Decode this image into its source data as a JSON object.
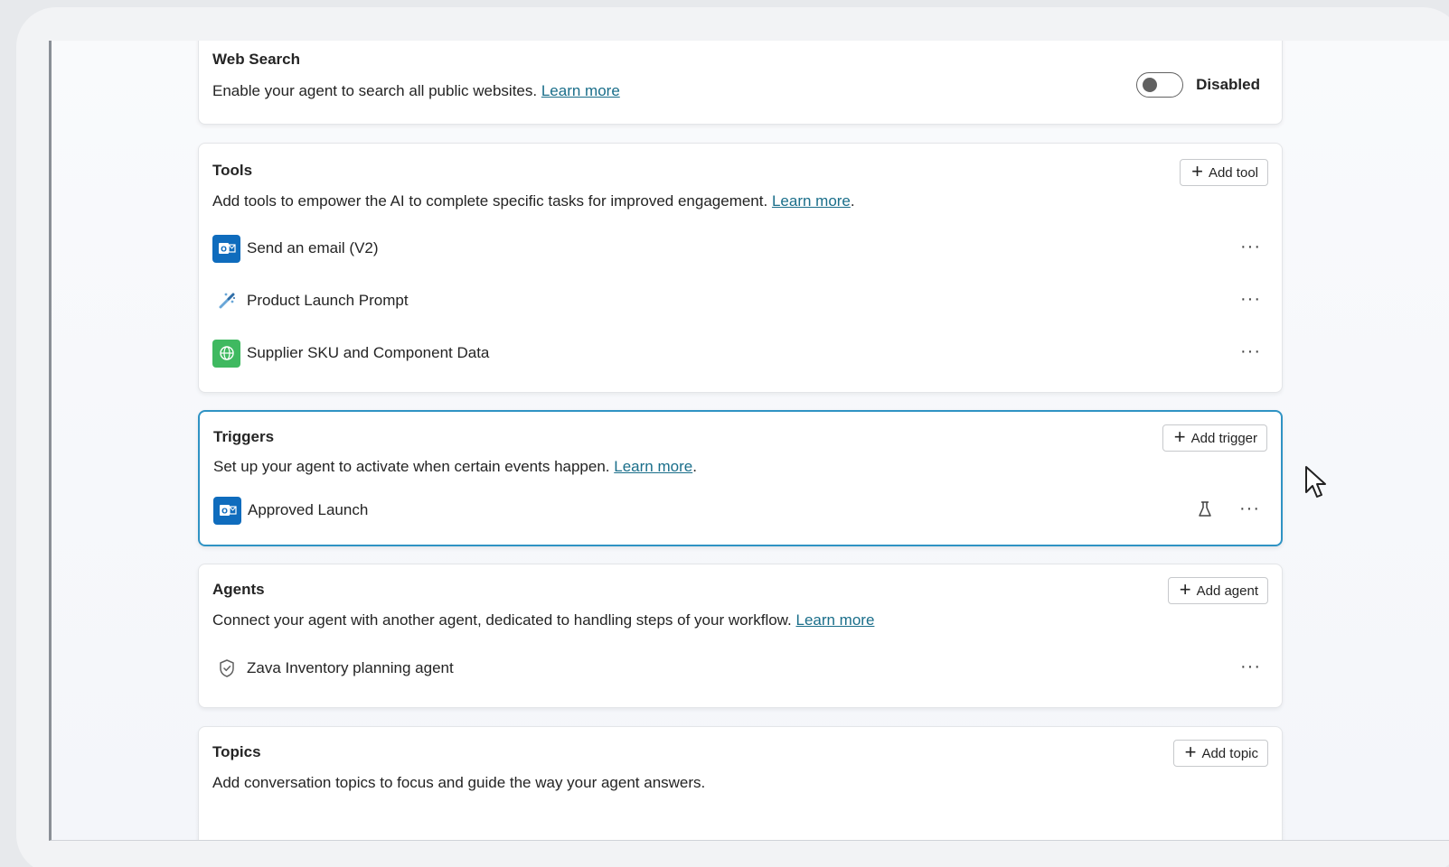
{
  "web_search": {
    "title": "Web Search",
    "description": "Enable your agent to search all public websites.",
    "link": "Learn more",
    "toggle_state": "Disabled"
  },
  "tools": {
    "title": "Tools",
    "description": "Add tools to empower the AI to complete specific tasks for improved engagement.",
    "link": "Learn more",
    "link_suffix": ".",
    "add_label": "Add tool",
    "items": [
      {
        "label": "Send an email (V2)",
        "icon": "outlook-icon"
      },
      {
        "label": "Product Launch Prompt",
        "icon": "prompt-icon"
      },
      {
        "label": "Supplier SKU and Component Data",
        "icon": "dataverse-icon"
      }
    ]
  },
  "triggers": {
    "title": "Triggers",
    "description": "Set up your agent to activate when certain events happen.",
    "link": "Learn more",
    "link_suffix": ".",
    "add_label": "Add trigger",
    "items": [
      {
        "label": "Approved Launch",
        "icon": "outlook-icon"
      }
    ]
  },
  "agents": {
    "title": "Agents",
    "description": "Connect your agent with another agent, dedicated to handling steps of your workflow.",
    "link": "Learn more",
    "add_label": "Add agent",
    "items": [
      {
        "label": "Zava Inventory planning agent",
        "icon": "shield-icon"
      }
    ]
  },
  "topics": {
    "title": "Topics",
    "description": "Add conversation topics to focus and guide the way your agent answers.",
    "add_label": "Add topic"
  },
  "more_glyph": "···",
  "colors": {
    "accent_link": "#1a6e8a",
    "selected_border": "#2f93c4",
    "outlook_blue": "#0f6cbd",
    "dataverse_green": "#3fb960"
  }
}
